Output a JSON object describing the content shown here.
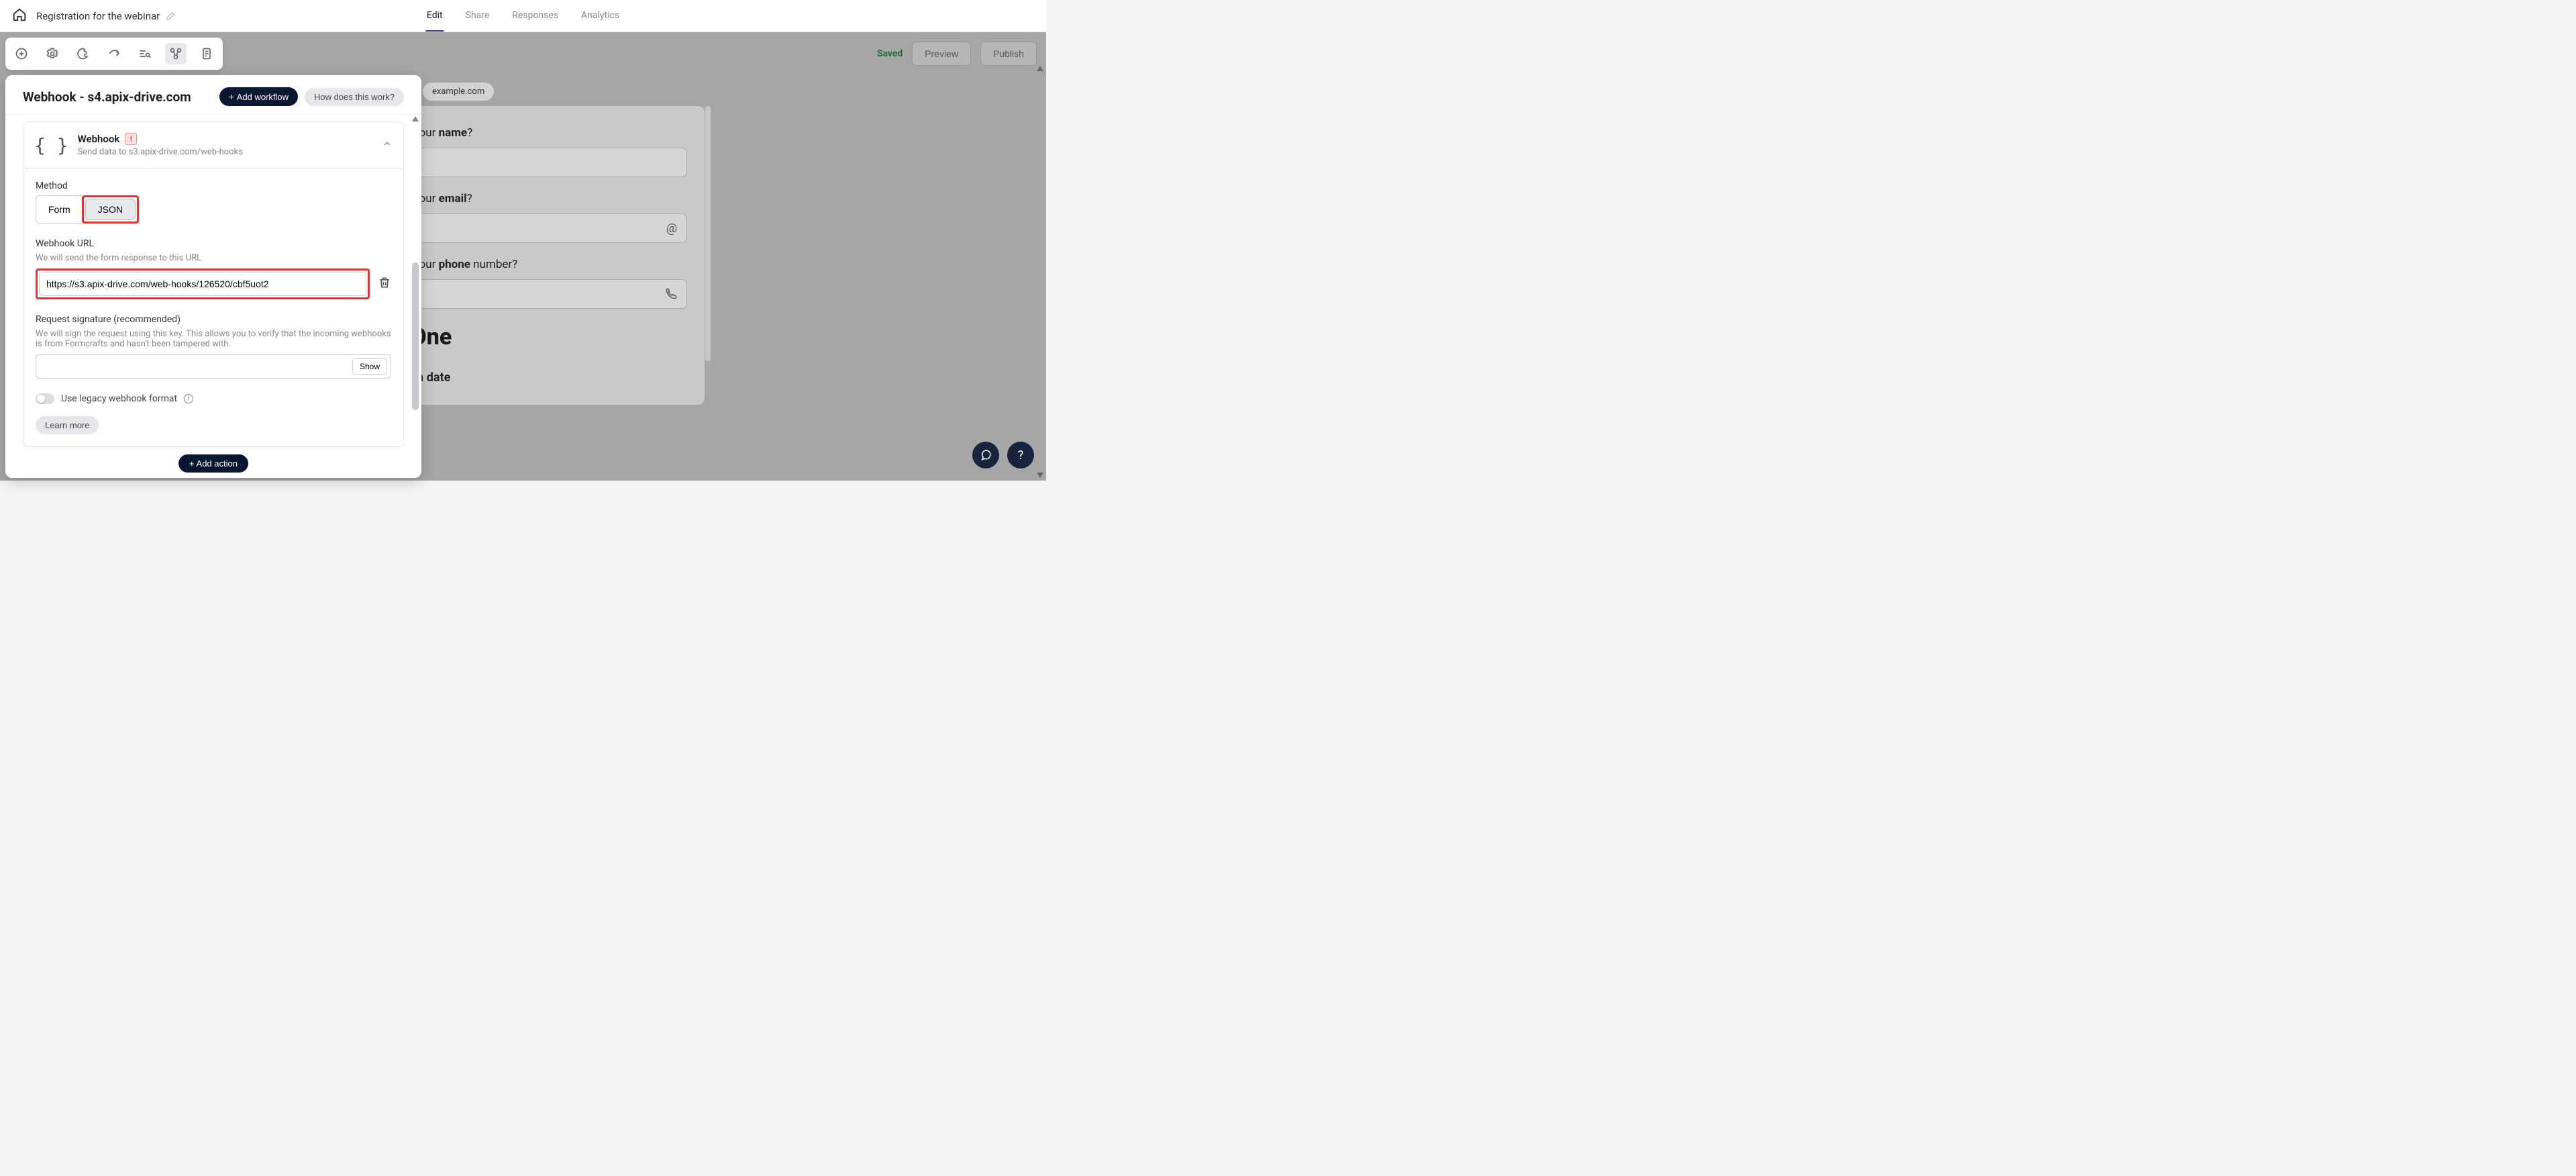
{
  "header": {
    "title": "Registration for the webinar",
    "tabs": {
      "edit": "Edit",
      "share": "Share",
      "responses": "Responses",
      "analytics": "Analytics"
    }
  },
  "status": {
    "saved": "Saved",
    "preview": "Preview",
    "publish": "Publish"
  },
  "popup": {
    "title": "Webhook - s4.apix-drive.com",
    "add_workflow": "Add workflow",
    "how_does": "How does this work?",
    "wf_name": "Webhook",
    "wf_desc": "Send data to s3.apix-drive.com/web-hooks",
    "method_label": "Method",
    "method_form": "Form",
    "method_json": "JSON",
    "url_label": "Webhook URL",
    "url_sub": "We will send the form response to this URL",
    "url_value": "https://s3.apix-drive.com/web-hooks/126520/cbf5uot2",
    "sig_label": "Request signature (recommended)",
    "sig_sub": "We will sign the request using this key. This allows you to verify that the incoming webhooks is from Formcrafts and hasn't been tampered with.",
    "show": "Show",
    "legacy": "Use legacy webhook format",
    "learn_more": "Learn more",
    "add_action": "Add action"
  },
  "form": {
    "chip": "example.com",
    "q1_pre": "What is your ",
    "q1_b": "name",
    "q1_post": "?",
    "q2_pre": "What is your ",
    "q2_b": "email",
    "q2_post": "?",
    "q3_pre": "What is your ",
    "q3_b": "phone",
    "q3_post": " number?",
    "heading_suffix": "ing One",
    "choose_pre": "Choose a ",
    "choose_b": "date"
  }
}
